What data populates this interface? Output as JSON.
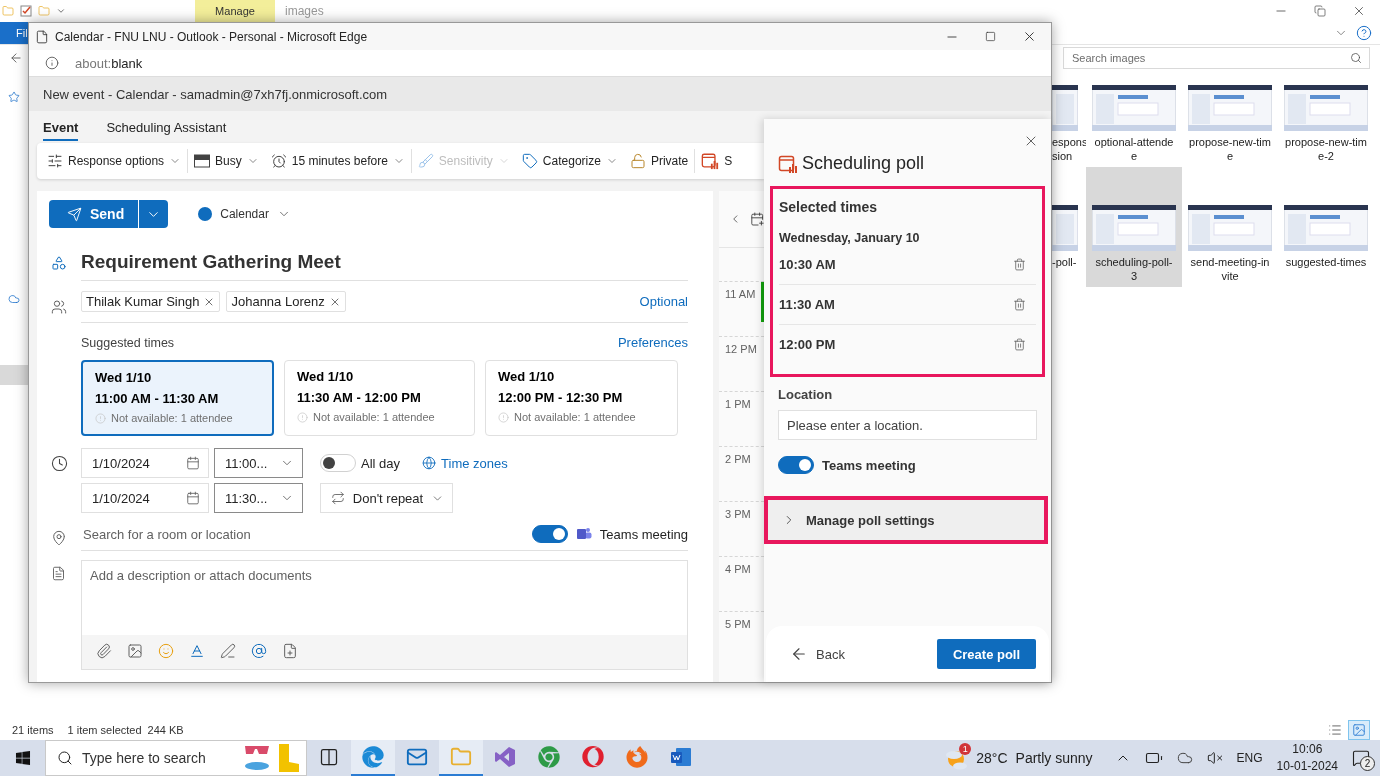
{
  "explorer": {
    "ribbon_tab": "Manage",
    "folder_title": "images",
    "file_tab": "Fil",
    "search": {
      "placeholder": "Search images"
    },
    "files": [
      {
        "label": "espons\nsion",
        "selected": false
      },
      {
        "label": "optional-attende\ne",
        "selected": false
      },
      {
        "label": "propose-new-tim\ne",
        "selected": false
      },
      {
        "label": "propose-new-tim\ne-2",
        "selected": false
      },
      {
        "label": "-poll-",
        "selected": false
      },
      {
        "label": "scheduling-poll-\n3",
        "selected": true
      },
      {
        "label": "send-meeting-in\nvite",
        "selected": false
      },
      {
        "label": "suggested-times",
        "selected": false
      }
    ],
    "status": {
      "count": "21 items",
      "selection": "1 item selected",
      "size": "244 KB"
    }
  },
  "browser": {
    "title": "Calendar - FNU LNU - Outlook - Personal - Microsoft Edge",
    "address_scheme": "about:",
    "address_page": "blank"
  },
  "outlook": {
    "header": "New event - Calendar - samadmin@7xh7fj.onmicrosoft.com",
    "tabs": [
      {
        "label": "Event",
        "selected": true
      },
      {
        "label": "Scheduling Assistant",
        "selected": false
      }
    ],
    "ribbon": [
      {
        "kind": "sliders",
        "label": "Response options",
        "dropdown": true,
        "disabled": false
      },
      {
        "kind": "busy",
        "label": "Busy",
        "dropdown": true,
        "disabled": false
      },
      {
        "kind": "alarm",
        "label": "15 minutes before",
        "dropdown": true,
        "disabled": false
      },
      {
        "kind": "brush",
        "label": "Sensitivity",
        "dropdown": true,
        "disabled": true
      },
      {
        "kind": "tag",
        "label": "Categorize",
        "dropdown": true,
        "disabled": false
      },
      {
        "kind": "lock",
        "label": "Private",
        "dropdown": false,
        "disabled": false
      },
      {
        "kind": "poll",
        "label": "S",
        "dropdown": false,
        "disabled": false
      }
    ],
    "send": "Send",
    "calendar": "Calendar",
    "title": "Requirement Gathering Meet",
    "attendees": [
      "Thilak Kumar Singh",
      "Johanna Lorenz"
    ],
    "optional": "Optional",
    "suggested": {
      "label": "Suggested times",
      "link": "Preferences",
      "slots": [
        {
          "day": "Wed 1/10",
          "time": "11:00 AM - 11:30 AM",
          "note": "Not available: 1 attendee",
          "selected": true
        },
        {
          "day": "Wed 1/10",
          "time": "11:30 AM - 12:00 PM",
          "note": "Not available: 1 attendee",
          "selected": false
        },
        {
          "day": "Wed 1/10",
          "time": "12:00 PM - 12:30 PM",
          "note": "Not available: 1 attendee",
          "selected": false
        }
      ]
    },
    "start": {
      "date": "1/10/2024",
      "time": "11:00..."
    },
    "end": {
      "date": "1/10/2024",
      "time": "11:30..."
    },
    "all_day": {
      "label": "All day",
      "on": false
    },
    "time_zones": "Time zones",
    "repeat": "Don't repeat",
    "location": {
      "placeholder": "Search for a room or location"
    },
    "teams": {
      "label": "Teams meeting",
      "on": true
    },
    "description": {
      "placeholder": "Add a description or attach documents"
    },
    "hours": [
      "11 AM",
      "12 PM",
      "1 PM",
      "2 PM",
      "3 PM",
      "4 PM",
      "5 PM"
    ]
  },
  "poll": {
    "title": "Scheduling poll",
    "section_title": "Selected times",
    "date": "Wednesday, January 10",
    "times": [
      "10:30 AM",
      "11:30 AM",
      "12:00 PM"
    ],
    "location_label": "Location",
    "location_placeholder": "Please enter a location.",
    "teams": {
      "label": "Teams meeting",
      "on": true
    },
    "settings": {
      "label": "Manage poll settings",
      "expanded": false
    },
    "back": "Back",
    "create": "Create poll"
  },
  "taskbar": {
    "search_placeholder": "Type here to search",
    "apps": [
      {
        "kind": "taskview",
        "running": false
      },
      {
        "kind": "edge",
        "running": true
      },
      {
        "kind": "mail",
        "running": false
      },
      {
        "kind": "folder",
        "running": true
      },
      {
        "kind": "studio",
        "running": false
      },
      {
        "kind": "chrome",
        "running": false
      },
      {
        "kind": "opera",
        "running": false
      },
      {
        "kind": "firefox",
        "running": false
      },
      {
        "kind": "word",
        "running": false
      }
    ],
    "weather_badge": "1",
    "temperature": "28°C",
    "condition": "Partly sunny",
    "language": "ENG",
    "time": "10:06",
    "date": "10-01-2024",
    "notifications": "2"
  }
}
